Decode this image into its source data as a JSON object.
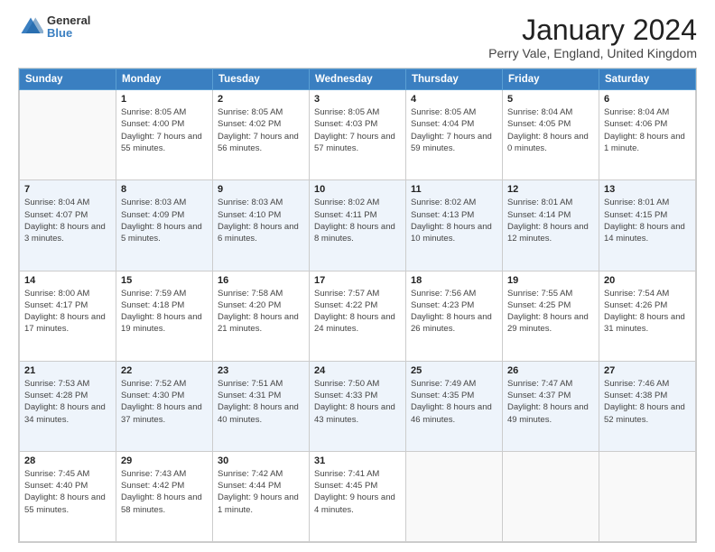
{
  "logo": {
    "general": "General",
    "blue": "Blue"
  },
  "title": "January 2024",
  "subtitle": "Perry Vale, England, United Kingdom",
  "days_of_week": [
    "Sunday",
    "Monday",
    "Tuesday",
    "Wednesday",
    "Thursday",
    "Friday",
    "Saturday"
  ],
  "weeks": [
    [
      {
        "day": "",
        "sunrise": "",
        "sunset": "",
        "daylight": ""
      },
      {
        "day": "1",
        "sunrise": "Sunrise: 8:05 AM",
        "sunset": "Sunset: 4:00 PM",
        "daylight": "Daylight: 7 hours and 55 minutes."
      },
      {
        "day": "2",
        "sunrise": "Sunrise: 8:05 AM",
        "sunset": "Sunset: 4:02 PM",
        "daylight": "Daylight: 7 hours and 56 minutes."
      },
      {
        "day": "3",
        "sunrise": "Sunrise: 8:05 AM",
        "sunset": "Sunset: 4:03 PM",
        "daylight": "Daylight: 7 hours and 57 minutes."
      },
      {
        "day": "4",
        "sunrise": "Sunrise: 8:05 AM",
        "sunset": "Sunset: 4:04 PM",
        "daylight": "Daylight: 7 hours and 59 minutes."
      },
      {
        "day": "5",
        "sunrise": "Sunrise: 8:04 AM",
        "sunset": "Sunset: 4:05 PM",
        "daylight": "Daylight: 8 hours and 0 minutes."
      },
      {
        "day": "6",
        "sunrise": "Sunrise: 8:04 AM",
        "sunset": "Sunset: 4:06 PM",
        "daylight": "Daylight: 8 hours and 1 minute."
      }
    ],
    [
      {
        "day": "7",
        "sunrise": "Sunrise: 8:04 AM",
        "sunset": "Sunset: 4:07 PM",
        "daylight": "Daylight: 8 hours and 3 minutes."
      },
      {
        "day": "8",
        "sunrise": "Sunrise: 8:03 AM",
        "sunset": "Sunset: 4:09 PM",
        "daylight": "Daylight: 8 hours and 5 minutes."
      },
      {
        "day": "9",
        "sunrise": "Sunrise: 8:03 AM",
        "sunset": "Sunset: 4:10 PM",
        "daylight": "Daylight: 8 hours and 6 minutes."
      },
      {
        "day": "10",
        "sunrise": "Sunrise: 8:02 AM",
        "sunset": "Sunset: 4:11 PM",
        "daylight": "Daylight: 8 hours and 8 minutes."
      },
      {
        "day": "11",
        "sunrise": "Sunrise: 8:02 AM",
        "sunset": "Sunset: 4:13 PM",
        "daylight": "Daylight: 8 hours and 10 minutes."
      },
      {
        "day": "12",
        "sunrise": "Sunrise: 8:01 AM",
        "sunset": "Sunset: 4:14 PM",
        "daylight": "Daylight: 8 hours and 12 minutes."
      },
      {
        "day": "13",
        "sunrise": "Sunrise: 8:01 AM",
        "sunset": "Sunset: 4:15 PM",
        "daylight": "Daylight: 8 hours and 14 minutes."
      }
    ],
    [
      {
        "day": "14",
        "sunrise": "Sunrise: 8:00 AM",
        "sunset": "Sunset: 4:17 PM",
        "daylight": "Daylight: 8 hours and 17 minutes."
      },
      {
        "day": "15",
        "sunrise": "Sunrise: 7:59 AM",
        "sunset": "Sunset: 4:18 PM",
        "daylight": "Daylight: 8 hours and 19 minutes."
      },
      {
        "day": "16",
        "sunrise": "Sunrise: 7:58 AM",
        "sunset": "Sunset: 4:20 PM",
        "daylight": "Daylight: 8 hours and 21 minutes."
      },
      {
        "day": "17",
        "sunrise": "Sunrise: 7:57 AM",
        "sunset": "Sunset: 4:22 PM",
        "daylight": "Daylight: 8 hours and 24 minutes."
      },
      {
        "day": "18",
        "sunrise": "Sunrise: 7:56 AM",
        "sunset": "Sunset: 4:23 PM",
        "daylight": "Daylight: 8 hours and 26 minutes."
      },
      {
        "day": "19",
        "sunrise": "Sunrise: 7:55 AM",
        "sunset": "Sunset: 4:25 PM",
        "daylight": "Daylight: 8 hours and 29 minutes."
      },
      {
        "day": "20",
        "sunrise": "Sunrise: 7:54 AM",
        "sunset": "Sunset: 4:26 PM",
        "daylight": "Daylight: 8 hours and 31 minutes."
      }
    ],
    [
      {
        "day": "21",
        "sunrise": "Sunrise: 7:53 AM",
        "sunset": "Sunset: 4:28 PM",
        "daylight": "Daylight: 8 hours and 34 minutes."
      },
      {
        "day": "22",
        "sunrise": "Sunrise: 7:52 AM",
        "sunset": "Sunset: 4:30 PM",
        "daylight": "Daylight: 8 hours and 37 minutes."
      },
      {
        "day": "23",
        "sunrise": "Sunrise: 7:51 AM",
        "sunset": "Sunset: 4:31 PM",
        "daylight": "Daylight: 8 hours and 40 minutes."
      },
      {
        "day": "24",
        "sunrise": "Sunrise: 7:50 AM",
        "sunset": "Sunset: 4:33 PM",
        "daylight": "Daylight: 8 hours and 43 minutes."
      },
      {
        "day": "25",
        "sunrise": "Sunrise: 7:49 AM",
        "sunset": "Sunset: 4:35 PM",
        "daylight": "Daylight: 8 hours and 46 minutes."
      },
      {
        "day": "26",
        "sunrise": "Sunrise: 7:47 AM",
        "sunset": "Sunset: 4:37 PM",
        "daylight": "Daylight: 8 hours and 49 minutes."
      },
      {
        "day": "27",
        "sunrise": "Sunrise: 7:46 AM",
        "sunset": "Sunset: 4:38 PM",
        "daylight": "Daylight: 8 hours and 52 minutes."
      }
    ],
    [
      {
        "day": "28",
        "sunrise": "Sunrise: 7:45 AM",
        "sunset": "Sunset: 4:40 PM",
        "daylight": "Daylight: 8 hours and 55 minutes."
      },
      {
        "day": "29",
        "sunrise": "Sunrise: 7:43 AM",
        "sunset": "Sunset: 4:42 PM",
        "daylight": "Daylight: 8 hours and 58 minutes."
      },
      {
        "day": "30",
        "sunrise": "Sunrise: 7:42 AM",
        "sunset": "Sunset: 4:44 PM",
        "daylight": "Daylight: 9 hours and 1 minute."
      },
      {
        "day": "31",
        "sunrise": "Sunrise: 7:41 AM",
        "sunset": "Sunset: 4:45 PM",
        "daylight": "Daylight: 9 hours and 4 minutes."
      },
      {
        "day": "",
        "sunrise": "",
        "sunset": "",
        "daylight": ""
      },
      {
        "day": "",
        "sunrise": "",
        "sunset": "",
        "daylight": ""
      },
      {
        "day": "",
        "sunrise": "",
        "sunset": "",
        "daylight": ""
      }
    ]
  ]
}
